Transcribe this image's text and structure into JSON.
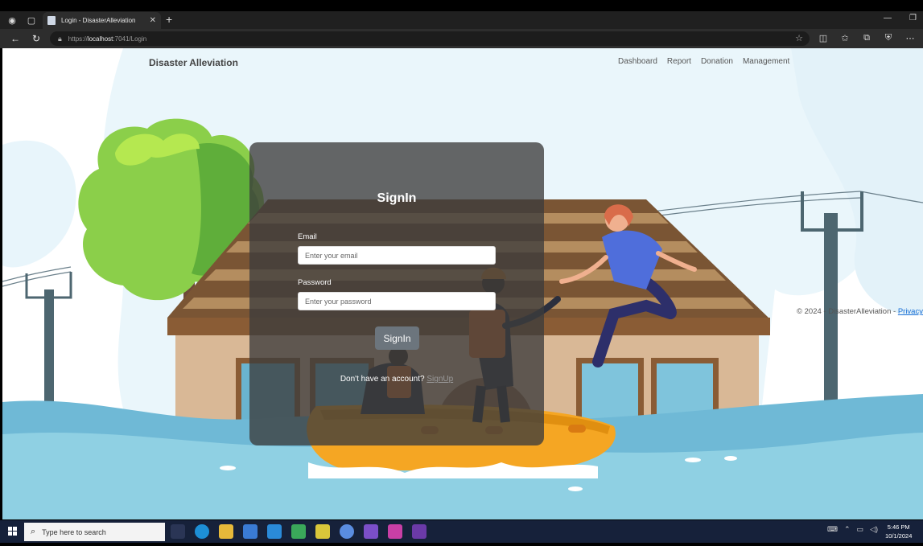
{
  "browser": {
    "tab_title": "Login - DisasterAlleviation",
    "url_prefix": "https://",
    "url_host": "localhost",
    "url_rest": ":7041/Login"
  },
  "site": {
    "brand": "Disaster Alleviation",
    "nav": [
      "Dashboard",
      "Report",
      "Donation",
      "Management"
    ],
    "footer_text": "© 2024 - DisasterAlleviation - ",
    "footer_link": "Privacy"
  },
  "login": {
    "title": "SignIn",
    "email_label": "Email",
    "email_placeholder": "Enter your email",
    "password_label": "Password",
    "password_placeholder": "Enter your password",
    "submit_label": "SignIn",
    "signup_prompt": "Don't have an account?",
    "signup_link": "SignUp"
  },
  "taskbar": {
    "search_placeholder": "Type here to search",
    "time": "5:46 PM",
    "date": "10/1/2024"
  },
  "colors": {
    "card_bg": "#3c3c3c",
    "button_bg": "#6c757d",
    "water": "#6fb9d6",
    "roof": "#7a5534",
    "tree": "#8bcf4a"
  }
}
